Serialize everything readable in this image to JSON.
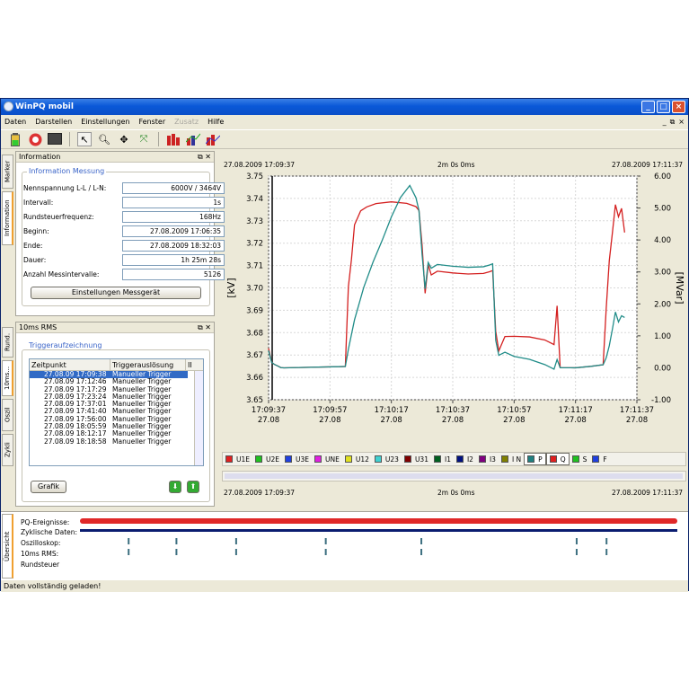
{
  "window": {
    "title": "WinPQ mobil"
  },
  "menu": [
    "Daten",
    "Darstellen",
    "Einstellungen",
    "Fenster",
    "Zusatz",
    "Hilfe"
  ],
  "menu_disabled": [
    "Zusatz"
  ],
  "toolbar_icons": [
    "battery-icon",
    "record-icon",
    "monitor-icon",
    "pointer-icon",
    "zoom-icon",
    "pan-icon",
    "fit-icon",
    "chart-red-icon",
    "chart-blue-icon",
    "chart-mixed-icon"
  ],
  "left_tabs_top": [
    "Marker",
    "Information"
  ],
  "left_tabs_mid": [
    "Rund.",
    "10ms...",
    "Oszil",
    "Zykli"
  ],
  "left_tabs_bottom": [
    "Übersicht"
  ],
  "info_panel": {
    "title": "Information",
    "group": "Information Messung",
    "rows": [
      {
        "label": "Nennspannung L-L / L-N:",
        "value": "6000V / 3464V"
      },
      {
        "label": "Intervall:",
        "value": "1s"
      },
      {
        "label": "Rundsteuerfrequenz:",
        "value": "168Hz"
      },
      {
        "label": "Beginn:",
        "value": "27.08.2009 17:06:35"
      },
      {
        "label": "Ende:",
        "value": "27.08.2009 18:32:03"
      },
      {
        "label": "Dauer:",
        "value": "1h 25m 28s"
      },
      {
        "label": "Anzahl Messintervalle:",
        "value": "5126"
      }
    ],
    "button": "Einstellungen Messgerät"
  },
  "trigger_panel": {
    "title": "10ms RMS",
    "group": "Triggeraufzeichnung",
    "columns": [
      "Zeitpunkt",
      "Triggerauslösung",
      "II"
    ],
    "rows": [
      [
        "27.08.09 17:09:38",
        "Manueller Trigger"
      ],
      [
        "27.08.09 17:12:46",
        "Manueller Trigger"
      ],
      [
        "27.08.09 17:17:29",
        "Manueller Trigger"
      ],
      [
        "27.08.09 17:23:24",
        "Manueller Trigger"
      ],
      [
        "27.08.09 17:37:01",
        "Manueller Trigger"
      ],
      [
        "27.08.09 17:41:40",
        "Manueller Trigger"
      ],
      [
        "27.08.09 17:56:00",
        "Manueller Trigger"
      ],
      [
        "27.08.09 18:05:59",
        "Manueller Trigger"
      ],
      [
        "27.08.09 18:12:17",
        "Manueller Trigger"
      ],
      [
        "27.08.09 18:18:58",
        "Manueller Trigger"
      ]
    ],
    "button": "Grafik"
  },
  "chart_header": {
    "left": "27.08.2009 17:09:37",
    "center": "2m 0s 0ms",
    "right": "27.08.2009 17:11:37"
  },
  "chart_footer": {
    "left": "27.08.2009 17:09:37",
    "center": "2m 0s 0ms",
    "right": "27.08.2009 17:11:37"
  },
  "legend": [
    {
      "name": "U1E",
      "color": "#e02020"
    },
    {
      "name": "U2E",
      "color": "#20c020"
    },
    {
      "name": "U3E",
      "color": "#2040e0"
    },
    {
      "name": "UNE",
      "color": "#e020e0"
    },
    {
      "name": "U12",
      "color": "#e0e020"
    },
    {
      "name": "U23",
      "color": "#40d0d0"
    },
    {
      "name": "U31",
      "color": "#800000"
    },
    {
      "name": "I1",
      "color": "#006020"
    },
    {
      "name": "I2",
      "color": "#001080"
    },
    {
      "name": "I3",
      "color": "#800080"
    },
    {
      "name": "I N",
      "color": "#808000"
    },
    {
      "name": "P",
      "color": "#208080",
      "boxed": true
    },
    {
      "name": "Q",
      "color": "#e02020",
      "boxed": true
    },
    {
      "name": "S",
      "color": "#20c020"
    },
    {
      "name": "F",
      "color": "#2040e0"
    }
  ],
  "chart_data": {
    "type": "line",
    "ylabel": "[kV]",
    "y2label": "[MVar]",
    "ylim": [
      3.65,
      3.75
    ],
    "y2lim": [
      -1.0,
      6.0
    ],
    "y_ticks": [
      "3.75",
      "3.74",
      "3.73",
      "3.72",
      "3.71",
      "3.70",
      "3.69",
      "3.68",
      "3.67",
      "3.66",
      "3.65"
    ],
    "y2_ticks": [
      "6.00",
      "5.00",
      "4.00",
      "3.00",
      "2.00",
      "1.00",
      "0.00",
      "-1.00"
    ],
    "x_ticks": [
      {
        "t": "17:09:37",
        "d": "27.08",
        "s": 0
      },
      {
        "t": "17:09:57",
        "d": "27.08",
        "s": 20
      },
      {
        "t": "17:10:17",
        "d": "27.08",
        "s": 40
      },
      {
        "t": "17:10:37",
        "d": "27.08",
        "s": 60
      },
      {
        "t": "17:10:57",
        "d": "27.08",
        "s": 80
      },
      {
        "t": "17:11:17",
        "d": "27.08",
        "s": 100
      },
      {
        "t": "17:11:37",
        "d": "27.08",
        "s": 120
      }
    ],
    "grid": true,
    "series": [
      {
        "name": "Q",
        "axis": "left",
        "color": "#d42020",
        "x": [
          0,
          1,
          2,
          3,
          4,
          5,
          25,
          26,
          27,
          28,
          30,
          32,
          35,
          40,
          45,
          48,
          49,
          50,
          51,
          52,
          53,
          55,
          60,
          65,
          70,
          72,
          73,
          74,
          75,
          77,
          80,
          85,
          90,
          93,
          94,
          95,
          100,
          105,
          109,
          110,
          111,
          112,
          113,
          114,
          115,
          116
        ],
        "y": [
          3.673,
          3.666,
          3.665,
          3.665,
          3.665,
          3.665,
          3.665,
          3.7,
          3.712,
          3.728,
          3.735,
          3.737,
          3.738,
          3.738,
          3.737,
          3.736,
          3.735,
          3.72,
          3.698,
          3.71,
          3.705,
          3.707,
          3.707,
          3.707,
          3.707,
          3.707,
          3.707,
          3.68,
          3.672,
          3.679,
          3.679,
          3.678,
          3.676,
          3.674,
          3.692,
          3.665,
          3.665,
          3.665,
          3.665,
          3.69,
          3.712,
          3.725,
          3.738,
          3.732,
          3.735,
          3.724
        ]
      },
      {
        "name": "P",
        "axis": "left",
        "color": "#208c88",
        "x": [
          0,
          1,
          2,
          3,
          4,
          5,
          25,
          26,
          28,
          31,
          34,
          37,
          40,
          43,
          46,
          48,
          49,
          50,
          51,
          52,
          53,
          55,
          60,
          65,
          70,
          72,
          73,
          74,
          75,
          77,
          80,
          85,
          90,
          93,
          94,
          95,
          100,
          105,
          109,
          110,
          111,
          112,
          113,
          114,
          115,
          116
        ],
        "y": [
          3.672,
          3.666,
          3.665,
          3.665,
          3.665,
          3.665,
          3.665,
          3.672,
          3.685,
          3.7,
          3.712,
          3.722,
          3.732,
          3.74,
          3.745,
          3.74,
          3.735,
          3.716,
          3.7,
          3.711,
          3.708,
          3.71,
          3.71,
          3.71,
          3.71,
          3.71,
          3.71,
          3.676,
          3.67,
          3.672,
          3.67,
          3.668,
          3.665,
          3.663,
          3.668,
          3.665,
          3.665,
          3.665,
          3.665,
          3.668,
          3.674,
          3.682,
          3.69,
          3.685,
          3.687,
          3.686
        ]
      }
    ]
  },
  "overview": {
    "labels": [
      "PQ-Ereignisse:",
      "Zyklische Daten:",
      "Oszilloskop:",
      "10ms RMS:",
      "Rundsteuer"
    ],
    "marks": [
      0.08,
      0.16,
      0.26,
      0.41,
      0.57,
      0.83,
      0.88
    ],
    "osc_marks": [
      0.08,
      0.16,
      0.26,
      0.41,
      0.57,
      0.83,
      0.88
    ]
  },
  "status": "Daten vollständig geladen!"
}
